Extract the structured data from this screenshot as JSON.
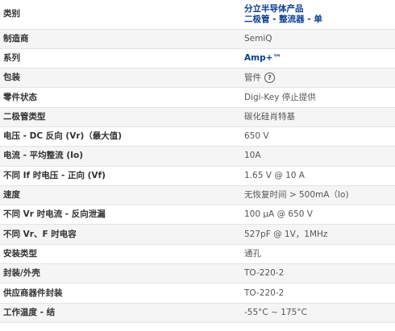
{
  "header": {
    "label": "类别",
    "category_line1": "分立半导体产品",
    "category_line2": "二极管 - 整流器 - 单"
  },
  "rows": [
    {
      "label": "制造商",
      "value": "SemiQ"
    },
    {
      "label": "系列",
      "value": "Amp+™"
    },
    {
      "label": "包装",
      "value": "管件"
    },
    {
      "label": "零件状态",
      "value": "Digi-Key 停止提供"
    },
    {
      "label": "二极管类型",
      "value": "碳化硅肖特基"
    },
    {
      "label": "电压 - DC 反向 (Vr)（最大值)",
      "value": "650 V"
    },
    {
      "label": "电流 - 平均整流 (Io)",
      "value": "10A"
    },
    {
      "label": "不同 If 时电压 - 正向 (Vf)",
      "value": "1.65 V @ 10 A"
    },
    {
      "label": "速度",
      "value": "无恢复时间 > 500mA（Io)"
    },
    {
      "label": "不同 Vr 时电流 - 反向泄漏",
      "value": "100 µA @ 650 V"
    },
    {
      "label": "不同 Vr、F 时电容",
      "value": "527pF @ 1V，1MHz"
    },
    {
      "label": "安装类型",
      "value": "通孔"
    },
    {
      "label": "封装/外壳",
      "value": "TO-220-2"
    },
    {
      "label": "供应商器件封装",
      "value": "TO-220-2"
    },
    {
      "label": "工作温度 - 结",
      "value": "-55°C ~ 175°C"
    }
  ],
  "icons": {
    "packaging_help": "question-circle-icon"
  },
  "colors": {
    "link": "#0a3d91",
    "row_shade": "#f5f5f5",
    "border": "#e3e3e3"
  }
}
